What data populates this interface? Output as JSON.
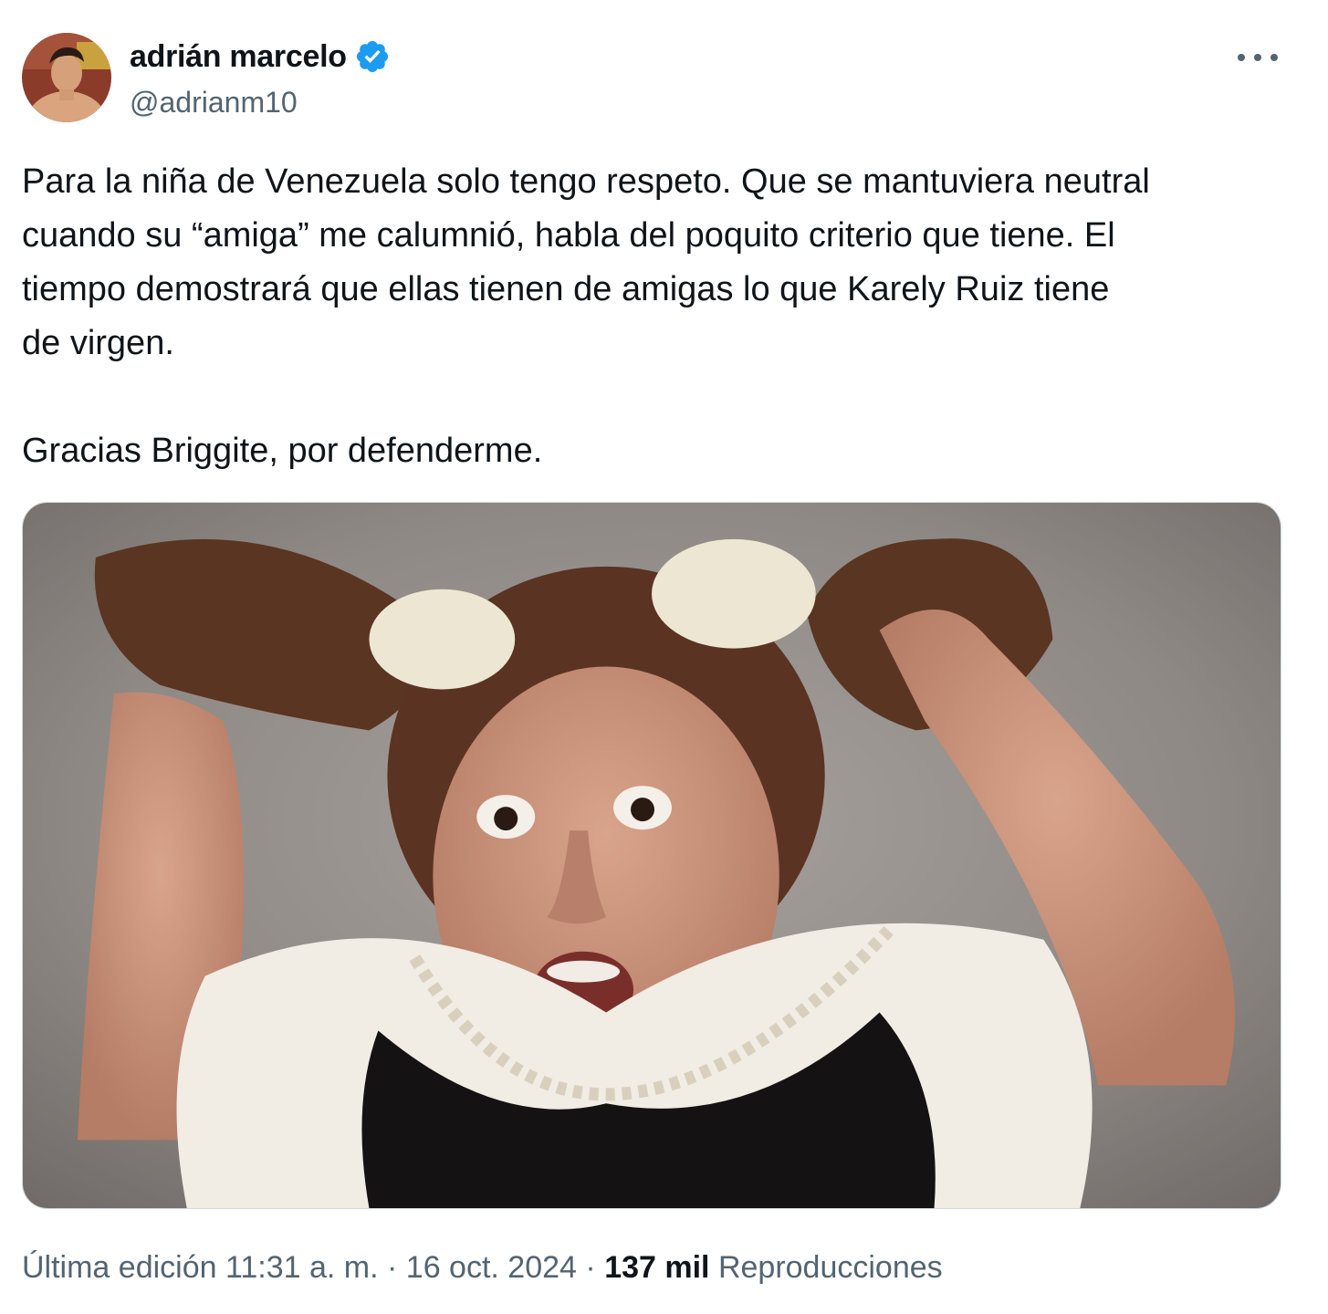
{
  "author": {
    "display_name": "adrián marcelo",
    "handle": "@adrianm10",
    "verified_color": "#1d9bf0"
  },
  "more_icon": "more-horizontal-icon",
  "tweet": {
    "text": "Para la niña de Venezuela solo tengo respeto. Que se mantuviera neutral\ncuando su “amiga” me calumnió, habla del poquito criterio que tiene. El\ntiempo demostrará que ellas tienen de amigas lo que Karely Ruiz tiene\nde virgen.\n\nGracias Briggite, por defenderme."
  },
  "meta": {
    "edited_label": "Última edición",
    "time": "11:31 a. m.",
    "separator": "·",
    "date": "16 oct. 2024",
    "views_count": "137 mil",
    "views_label": "Reproducciones"
  },
  "colors": {
    "text_primary": "#0f1419",
    "text_secondary": "#536471",
    "border": "#cfd9de"
  }
}
